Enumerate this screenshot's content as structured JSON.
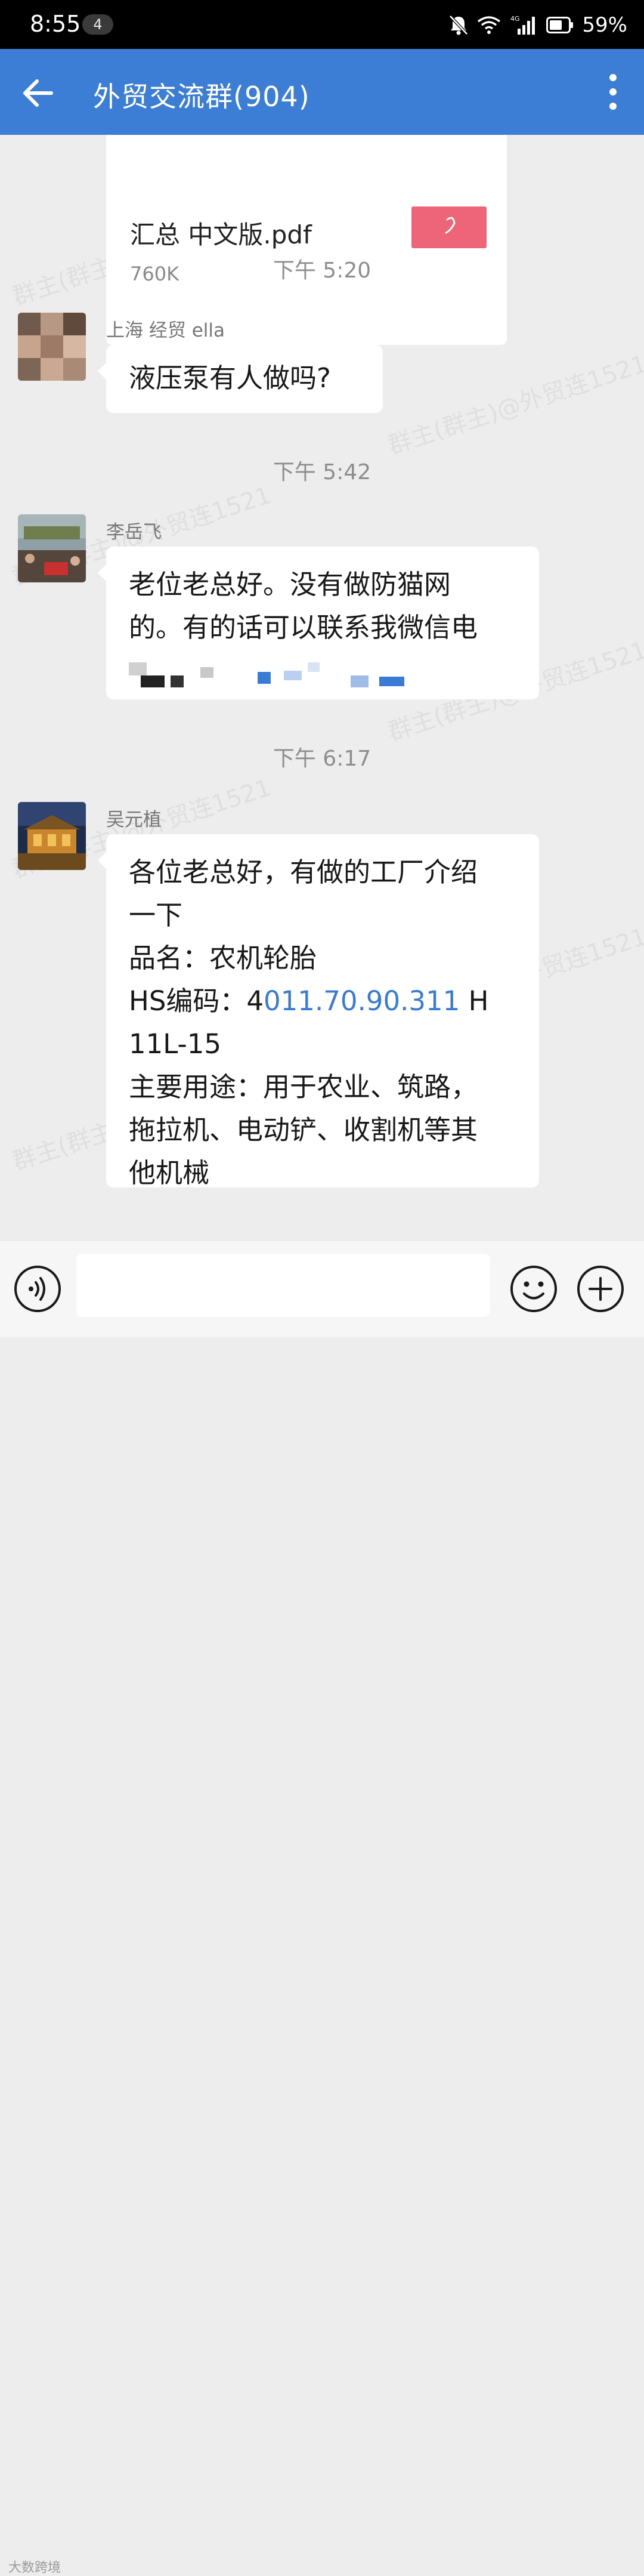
{
  "status_bar": {
    "time": "8:55",
    "notification_count": "4",
    "network": "4G",
    "battery": "59%"
  },
  "header": {
    "title": "外贸交流群(904)"
  },
  "watermark_text": "群主(群主)@外贸连1521",
  "file_message": {
    "name": "汇总 中文版.pdf",
    "size": "760K",
    "icon": "pdf-file-icon"
  },
  "messages": [
    {
      "time": "下午 5:20",
      "sender": "上海 经贸 ella",
      "lines": [
        "液压泵有人做吗?"
      ]
    },
    {
      "time": "下午 5:42",
      "sender": "李岳飞",
      "lines": [
        "老位老总好。没有做防猫网",
        "的。有的话可以联系我微信电"
      ]
    },
    {
      "time": "下午 6:17",
      "sender": "吴元植",
      "lines": [
        "各位老总好，有做的工厂介绍",
        "一下",
        "品名：农机轮胎",
        "主要用途：用于农业、筑路，",
        "拖拉机、电动铲、收割机等其",
        "他机械"
      ],
      "hs_line_prefix": "HS编码：4",
      "hs_line_link": "011.70.90.311",
      "hs_line_suffix": " H",
      "hs_line_2": "11L-15"
    }
  ],
  "input_bar": {
    "placeholder": "",
    "voice_icon": "voice-icon",
    "emoji_icon": "emoji-icon",
    "plus_icon": "plus-icon"
  },
  "corner_watermark": "大数跨境",
  "colors": {
    "app_bar": "#3c7dd5",
    "link": "#3a7bd5",
    "chat_background": "#ededed"
  }
}
